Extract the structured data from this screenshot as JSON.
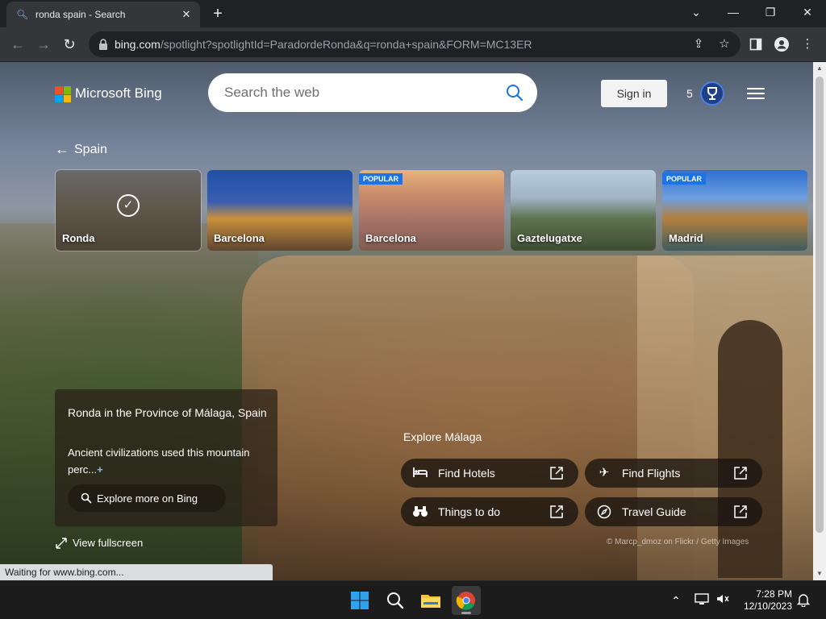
{
  "browser": {
    "tab_title": "ronda spain - Search",
    "tab_close": "✕",
    "new_tab": "+",
    "controls": {
      "minimize": "—",
      "maximize": "❐",
      "close": "✕",
      "tab_list": "⌄"
    },
    "url_host": "bing.com",
    "url_path": "/spotlight?spotlightId=ParadordeRonda&q=ronda+spain&FORM=MC13ER",
    "status": "Waiting for www.bing.com..."
  },
  "header": {
    "brand": "Microsoft Bing",
    "search_placeholder": "Search the web",
    "sign_in": "Sign in",
    "points": "5",
    "brand_colors": [
      "#f25022",
      "#7fba00",
      "#00a4ef",
      "#ffb900"
    ]
  },
  "breadcrumb": {
    "back_label": "Spain"
  },
  "carousel": [
    {
      "label": "Ronda",
      "badge": "",
      "selected": true
    },
    {
      "label": "Barcelona",
      "badge": "",
      "selected": false
    },
    {
      "label": "Barcelona",
      "badge": "POPULAR",
      "selected": false
    },
    {
      "label": "Gaztelugatxe",
      "badge": "",
      "selected": false
    },
    {
      "label": "Madrid",
      "badge": "POPULAR",
      "selected": false
    }
  ],
  "info": {
    "headline": "Ronda in the Province of Málaga, Spain",
    "description": "Ancient civilizations used this mountain perc...",
    "more": "+",
    "explore_button": "Explore more on Bing",
    "fullscreen": "View fullscreen"
  },
  "explore": {
    "title": "Explore Málaga",
    "links": [
      {
        "label": "Find Hotels",
        "icon": "bed-icon"
      },
      {
        "label": "Find Flights",
        "icon": "airplane-icon"
      },
      {
        "label": "Things to do",
        "icon": "binoculars-icon"
      },
      {
        "label": "Travel Guide",
        "icon": "compass-icon"
      }
    ]
  },
  "credit": "© Marcp_dmoz on Flickr / Getty Images",
  "taskbar": {
    "time": "7:28 PM",
    "date": "12/10/2023"
  }
}
